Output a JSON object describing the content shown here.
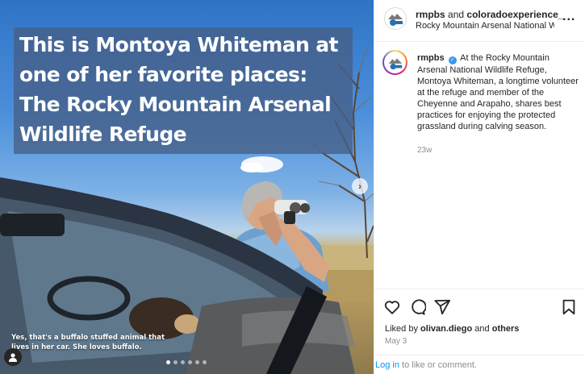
{
  "media": {
    "headline": "This is Montoya Whiteman at one of her favorite places: The Rocky Mountain Arsenal Wildlife Refuge",
    "caption": "Yes, that's a buffalo stuffed animal that lives in her car. She loves buffalo.",
    "carousel": {
      "total_slides": 6,
      "active_slide": 1
    },
    "icons": {
      "tag": "person-icon",
      "next": "chevron-right-icon"
    }
  },
  "header": {
    "author": "rmpbs",
    "and_text": "and",
    "coauthor": "coloradoexperience_",
    "location": "Rocky Mountain Arsenal National Wildlife Refuge",
    "more_label": "..."
  },
  "comment": {
    "user": "rmpbs",
    "text": "At the Rocky Mountain Arsenal National Wildlife Refuge, Montoya Whiteman, a longtime volunteer at the refuge and member of the Cheyenne and Arapaho, shares best practices for enjoying the protected grassland during calving season.",
    "time": "23w"
  },
  "engagement": {
    "liked_prefix": "Liked by",
    "liked_user": "olivan.diego",
    "liked_and": "and",
    "liked_others": "others",
    "date": "May 3"
  },
  "login": {
    "link": "Log in",
    "rest": "to like or comment."
  },
  "colors": {
    "link": "#0095f6",
    "verified": "#3897f0",
    "muted": "#8e8e8e"
  }
}
